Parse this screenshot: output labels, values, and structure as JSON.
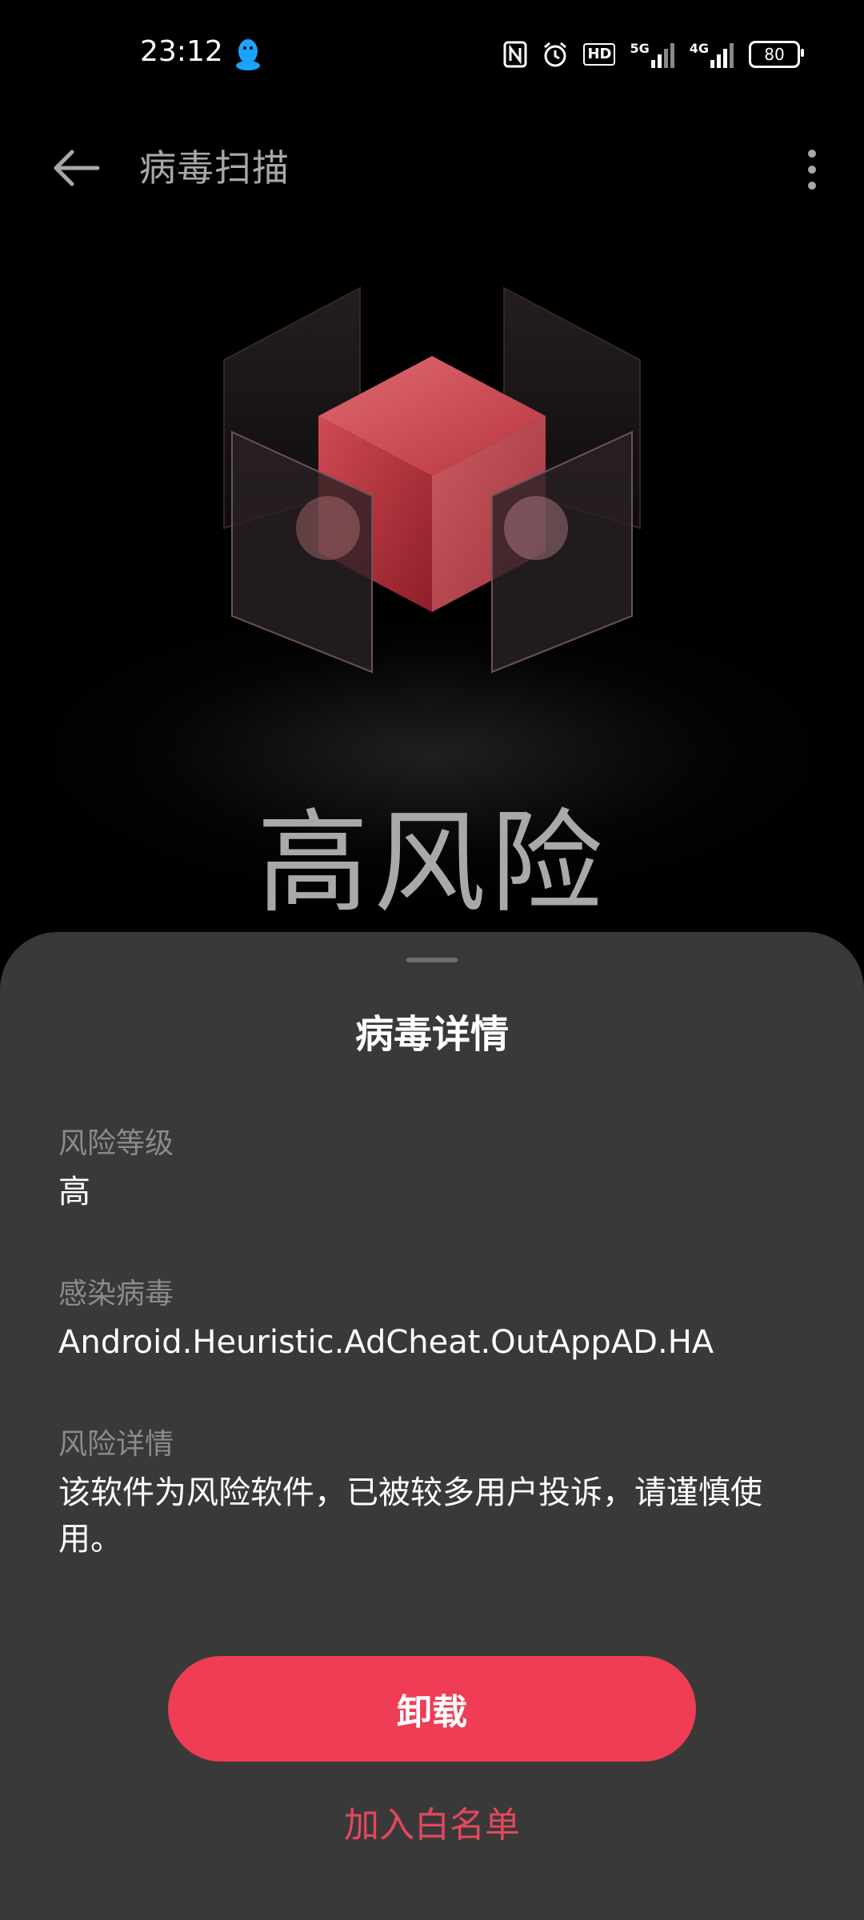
{
  "status_bar": {
    "time": "23:12",
    "network_5g": "5G",
    "network_4g": "4G",
    "battery": "80",
    "hd_label": "HD"
  },
  "app_bar": {
    "title": "病毒扫描"
  },
  "hero": {
    "risk_title": "高风险"
  },
  "sheet": {
    "title": "病毒详情",
    "risk_level_label": "风险等级",
    "risk_level_value": "高",
    "virus_label": "感染病毒",
    "virus_value": "Android.Heuristic.AdCheat.OutAppAD.HA",
    "detail_label": "风险详情",
    "detail_value": "该软件为风险软件，已被较多用户投诉，请谨慎使用。",
    "uninstall_label": "卸载",
    "whitelist_label": "加入白名单"
  },
  "colors": {
    "accent": "#ee3d55",
    "sheet_bg": "#393939",
    "background": "#000000"
  }
}
